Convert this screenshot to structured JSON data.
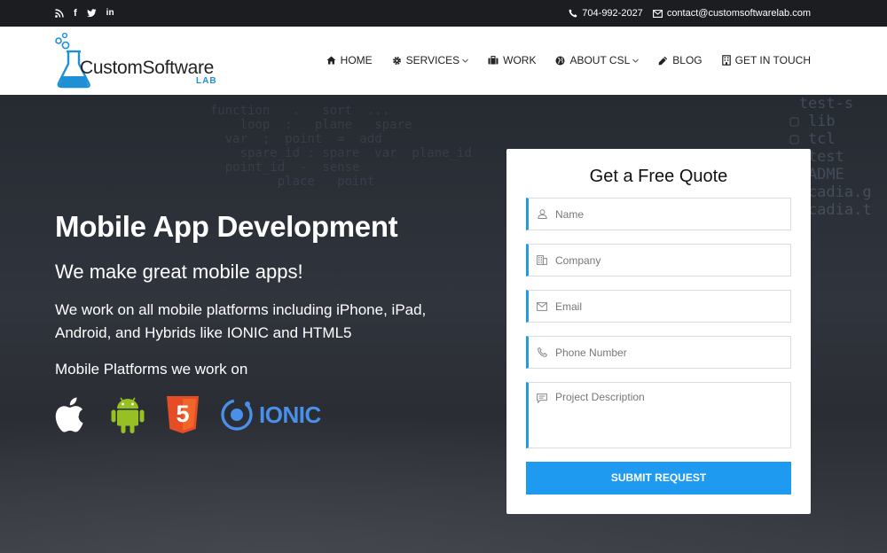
{
  "topbar": {
    "social": [
      "rss-icon",
      "facebook-icon",
      "twitter-icon",
      "linkedin-icon"
    ],
    "phone": "704-992-2027",
    "email": "contact@customsoftwarelab.com"
  },
  "logo": {
    "name": "CustomSoftware",
    "sub": "LAB"
  },
  "nav": [
    {
      "label": "HOME",
      "icon": "home-icon",
      "dropdown": false
    },
    {
      "label": "SERVICES",
      "icon": "gear-icon",
      "dropdown": true
    },
    {
      "label": "WORK",
      "icon": "briefcase-icon",
      "dropdown": false
    },
    {
      "label": "ABOUT CSL",
      "icon": "globe-icon",
      "dropdown": true
    },
    {
      "label": "BLOG",
      "icon": "pencil-icon",
      "dropdown": false
    },
    {
      "label": "GET IN TOUCH",
      "icon": "building-icon",
      "dropdown": false
    }
  ],
  "hero": {
    "title": "Mobile App Development",
    "subtitle": "We make great mobile apps!",
    "description": "We work on all mobile platforms including iPhone, iPad, Android,  and Hybrids like IONIC and HTML5",
    "platforms_label": "Mobile Platforms we work on",
    "ionic_word": "IONIC",
    "html5_mark": "5"
  },
  "quote_form": {
    "title": "Get a Free Quote",
    "fields": [
      {
        "placeholder": "Name",
        "icon": "user-icon",
        "value": ""
      },
      {
        "placeholder": "Company",
        "icon": "building-icon",
        "value": ""
      },
      {
        "placeholder": "Email",
        "icon": "envelope-icon",
        "value": ""
      },
      {
        "placeholder": "Phone Number",
        "icon": "phone-icon",
        "value": ""
      },
      {
        "placeholder": "Project Description",
        "icon": "comment-icon",
        "value": ""
      }
    ],
    "submit_label": "SUBMIT REQUEST"
  },
  "colors": {
    "accent": "#1e9af0",
    "topbar": "#1c1d20",
    "ionic": "#4a8fe8",
    "android": "#97c024",
    "html5": "#e44d26"
  }
}
